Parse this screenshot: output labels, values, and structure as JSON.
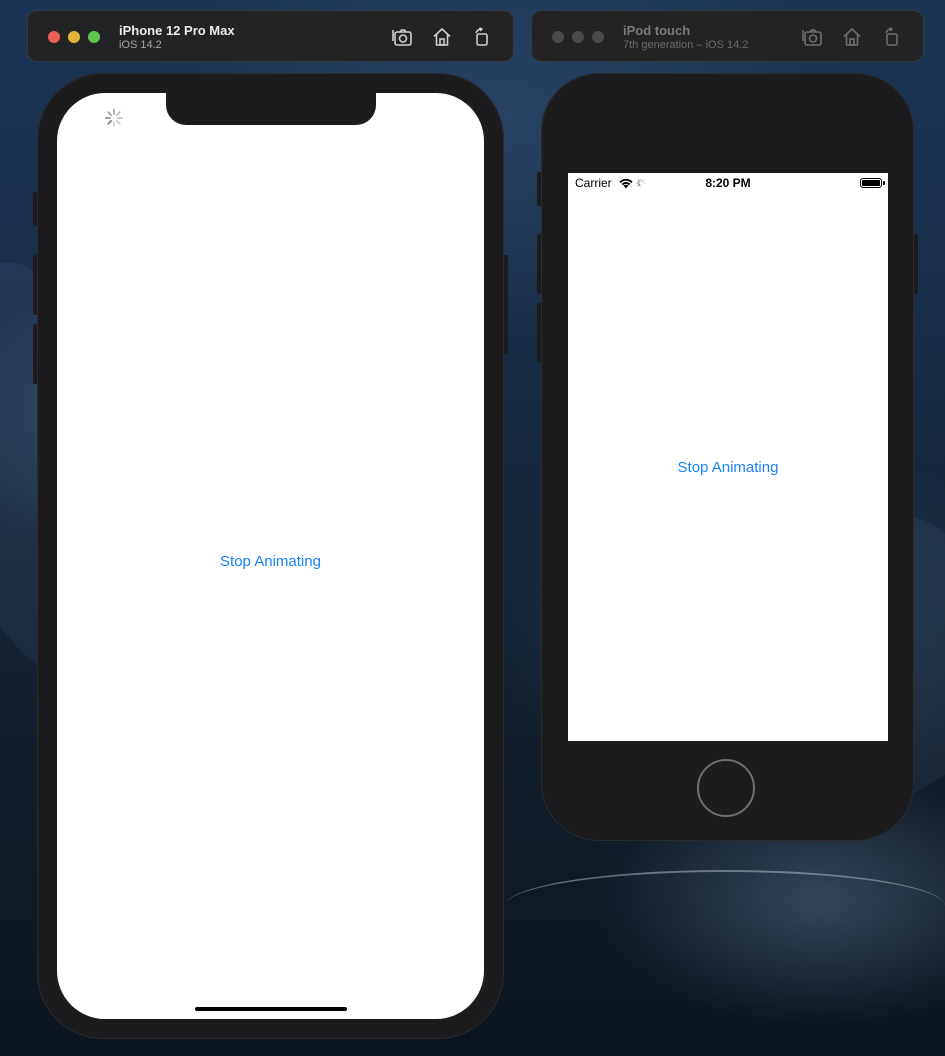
{
  "window_left": {
    "title": "iPhone 12 Pro Max",
    "subtitle": "iOS 14.2",
    "toolbar": [
      "screenshot-icon",
      "home-icon",
      "rotate-icon"
    ],
    "traffic_lights": {
      "close": "#ec5f57",
      "minimize": "#e3b43a",
      "zoom": "#5fc34e"
    }
  },
  "window_right": {
    "title": "iPod touch",
    "subtitle": "7th generation – iOS 14.2",
    "toolbar": [
      "screenshot-icon",
      "home-icon",
      "rotate-icon"
    ],
    "traffic_lights": {
      "close": "#4a4a4c",
      "minimize": "#4a4a4c",
      "zoom": "#4a4a4c"
    }
  },
  "iphone_screen": {
    "button_label": "Stop Animating",
    "button_color": "#1a82fb"
  },
  "ipod_screen": {
    "status_bar": {
      "carrier": "Carrier",
      "time": "8:20 PM"
    },
    "button_label": "Stop Animating",
    "button_color": "#1a82fb"
  }
}
